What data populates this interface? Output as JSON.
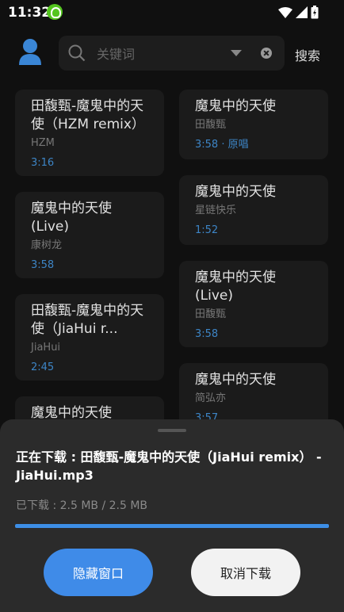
{
  "status_bar": {
    "time": "11:32"
  },
  "search": {
    "placeholder": "关键词",
    "button_label": "搜索"
  },
  "left_column": [
    {
      "title": "田馥甄-魔鬼中的天使（HZM remix）",
      "artist": "HZM",
      "meta": "3:16"
    },
    {
      "title": "魔鬼中的天使 (Live)",
      "artist": "康树龙",
      "meta": "3:58"
    },
    {
      "title": "田馥甄-魔鬼中的天使（JiaHui r...",
      "artist": "JiaHui",
      "meta": "2:45"
    },
    {
      "title": "魔鬼中的天使",
      "artist": "",
      "meta": ""
    }
  ],
  "right_column": [
    {
      "title": "魔鬼中的天使",
      "artist": "田馥甄",
      "meta": "3:58 · 原唱"
    },
    {
      "title": "魔鬼中的天使",
      "artist": "星链快乐",
      "meta": "1:52"
    },
    {
      "title": "魔鬼中的天使 (Live)",
      "artist": "田馥甄",
      "meta": "3:58"
    },
    {
      "title": "魔鬼中的天使",
      "artist": "简弘亦",
      "meta": "3:57"
    }
  ],
  "download": {
    "title": "正在下载 : 田馥甄-魔鬼中的天使（JiaHui remix） - JiaHui.mp3",
    "progress_text": "已下载 : 2.5 MB / 2.5 MB",
    "progress_fraction": 1.0,
    "hide_label": "隐藏窗口",
    "cancel_label": "取消下载"
  },
  "colors": {
    "accent": "#3f8be8",
    "background": "#101010",
    "meta_blue": "#3d85c6"
  },
  "icons": [
    "avatar-icon",
    "search-icon",
    "dropdown-icon",
    "clear-icon",
    "wifi-icon",
    "signal-icon",
    "battery-icon",
    "notification-app-icon"
  ]
}
